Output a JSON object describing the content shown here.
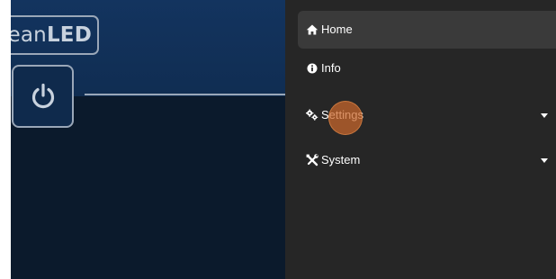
{
  "brand": {
    "logo_light": "cean",
    "logo_bold": "LED"
  },
  "power_button": {
    "icon": "power-icon"
  },
  "nav": {
    "items": [
      {
        "label": "Home",
        "icon": "home-icon",
        "active": true,
        "has_submenu": false
      },
      {
        "label": "Info",
        "icon": "info-icon",
        "active": false,
        "has_submenu": false
      },
      {
        "label": "Settings",
        "icon": "cogs-icon",
        "active": false,
        "has_submenu": true
      },
      {
        "label": "System",
        "icon": "tools-icon",
        "active": false,
        "has_submenu": true
      }
    ]
  },
  "colors": {
    "header_bg": "#13345f",
    "panel_bg": "#0b1a2c",
    "menu_bg": "#262626",
    "menu_active_bg": "#3a3a3a",
    "outline": "#9aa7b8",
    "cursor_highlight": "#cc682d"
  }
}
